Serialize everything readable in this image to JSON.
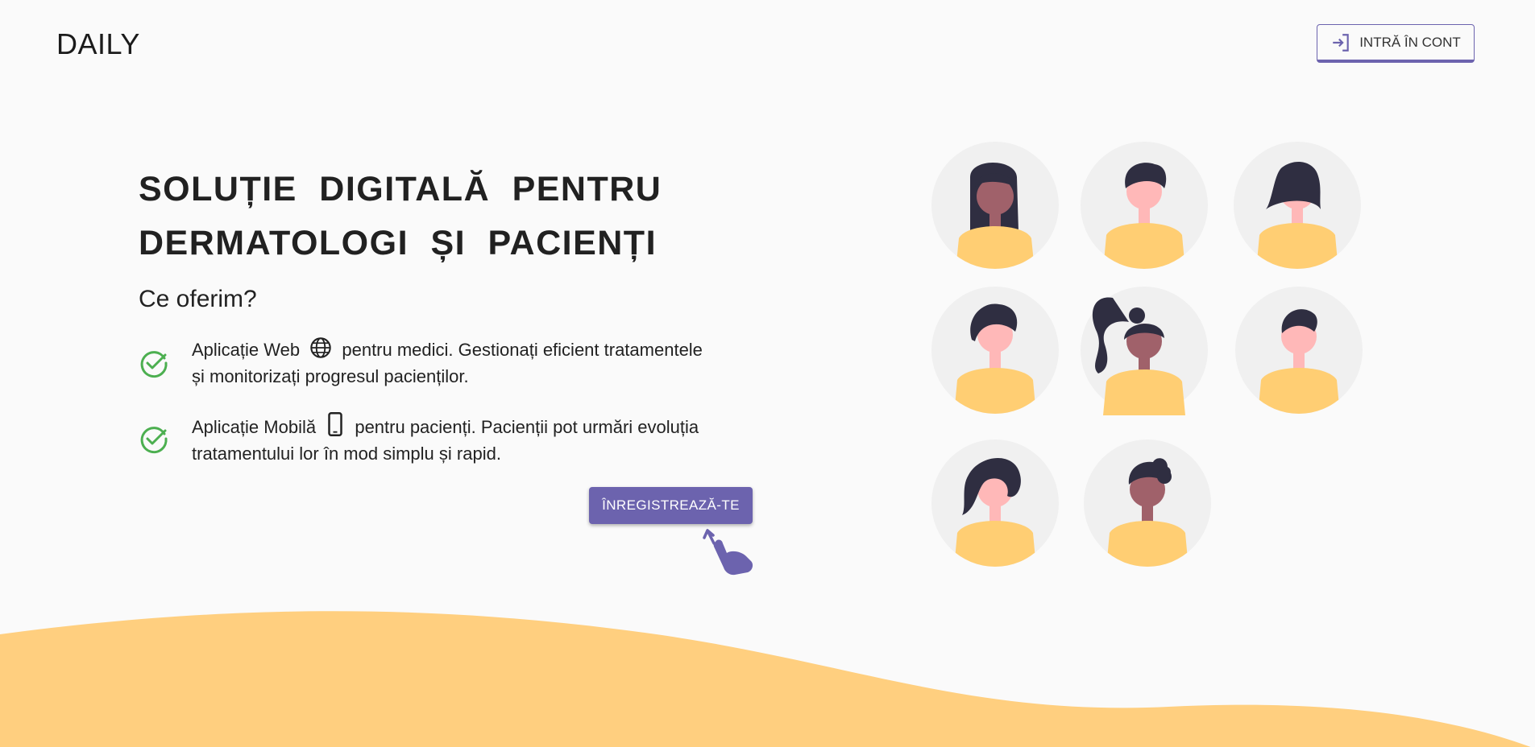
{
  "header": {
    "brand": "DAILY",
    "login_label": "INTRĂ ÎN CONT",
    "login_icon": "login-icon"
  },
  "hero": {
    "title_line1": "SOLUȚIE DIGITALĂ PENTRU",
    "title_line2": "DERMATOLOGI ȘI PACIENȚI",
    "subtitle": "Ce oferim?",
    "features": [
      {
        "icon": "check-circle-icon",
        "part1": "Aplicație Web",
        "inline_icon": "globe-icon",
        "part2": "pentru medici. Gestionați eficient tratamentele",
        "line2": "și monitorizați progresul pacienților."
      },
      {
        "icon": "check-circle-icon",
        "part1": "Aplicație Mobilă",
        "inline_icon": "smartphone-icon",
        "part2": "pentru pacienți. Pacienții pot urmări evoluția",
        "line2": "tratamentului lor în mod simplu și rapid."
      }
    ],
    "register_label": "ÎNREGISTREAZĂ-TE",
    "register_hint_icon": "tap-hand-icon"
  },
  "colors": {
    "accent": "#6c63ae",
    "check": "#4caf50",
    "wave": "#ffcf7f",
    "shirt": "#ffce73",
    "hair": "#2f2e41",
    "skin_light": "#ffb8b8",
    "skin_dark": "#a0616a",
    "avatar_bg": "#f0f0f0"
  },
  "avatars": [
    {
      "name": "avatar-woman-long-hair"
    },
    {
      "name": "avatar-man-short-hair"
    },
    {
      "name": "avatar-woman-bob-hair"
    },
    {
      "name": "avatar-man-side-hair"
    },
    {
      "name": "avatar-woman-ponytail"
    },
    {
      "name": "avatar-man-small-hair"
    },
    {
      "name": "avatar-woman-wavy-hair"
    },
    {
      "name": "avatar-man-curly-hair"
    }
  ]
}
